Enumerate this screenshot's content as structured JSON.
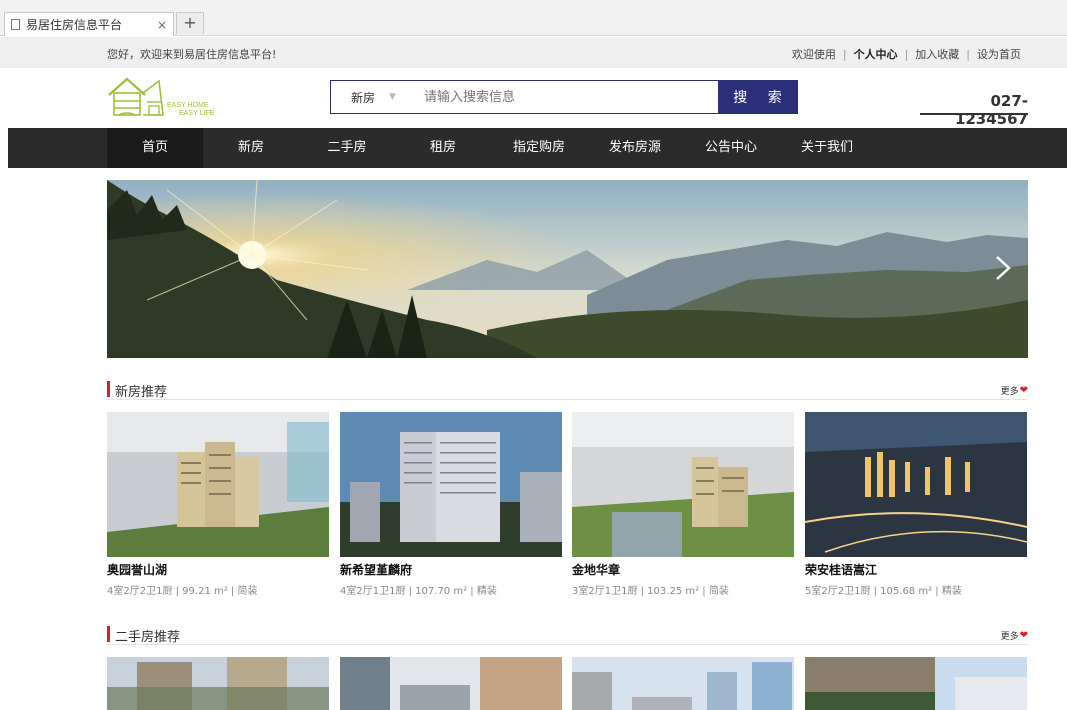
{
  "browser": {
    "tab_title": "易居住房信息平台",
    "tab_close": "×",
    "new_tab": "+"
  },
  "topbar": {
    "welcome": "您好，欢迎来到易居住房信息平台!",
    "links": [
      "欢迎使用",
      "个人中心",
      "加入收藏",
      "设为首页"
    ],
    "separator": "|"
  },
  "logo": {
    "mark": "易居",
    "tagline_1": "EASY HOME",
    "tagline_2": "EASY LIFE"
  },
  "search": {
    "type_label": "新房",
    "placeholder": "请输入搜索信息",
    "button_label": "搜 索"
  },
  "phone": "027-1234567",
  "nav": {
    "items": [
      "首页",
      "新房",
      "二手房",
      "租房",
      "指定购房",
      "发布房源",
      "公告中心",
      "关于我们"
    ],
    "active_index": 0
  },
  "sections": {
    "new": {
      "title": "新房推荐",
      "more": "更多",
      "cards": [
        {
          "name": "奥园誉山湖",
          "info": "4室2厅2卫1厨 | 99.21 m² | 简装"
        },
        {
          "name": "新希望堇麟府",
          "info": "4室2厅1卫1厨 | 107.70 m² | 精装"
        },
        {
          "name": "金地华章",
          "info": "3室2厅1卫1厨 | 103.25 m² | 简装"
        },
        {
          "name": "荣安桂语嵩江",
          "info": "5室2厅2卫1厨 | 105.68 m² | 精装"
        }
      ]
    },
    "used": {
      "title": "二手房推荐",
      "more": "更多"
    }
  },
  "colors": {
    "accent": "#d9202a",
    "search_button": "#2c307a",
    "nav_bg": "#2b2b2b",
    "logo_green": "#9cbf3b"
  },
  "icons": {
    "banner_next": "chevron-right-icon",
    "more_heart": "heart-icon",
    "tab_page": "document-icon"
  }
}
